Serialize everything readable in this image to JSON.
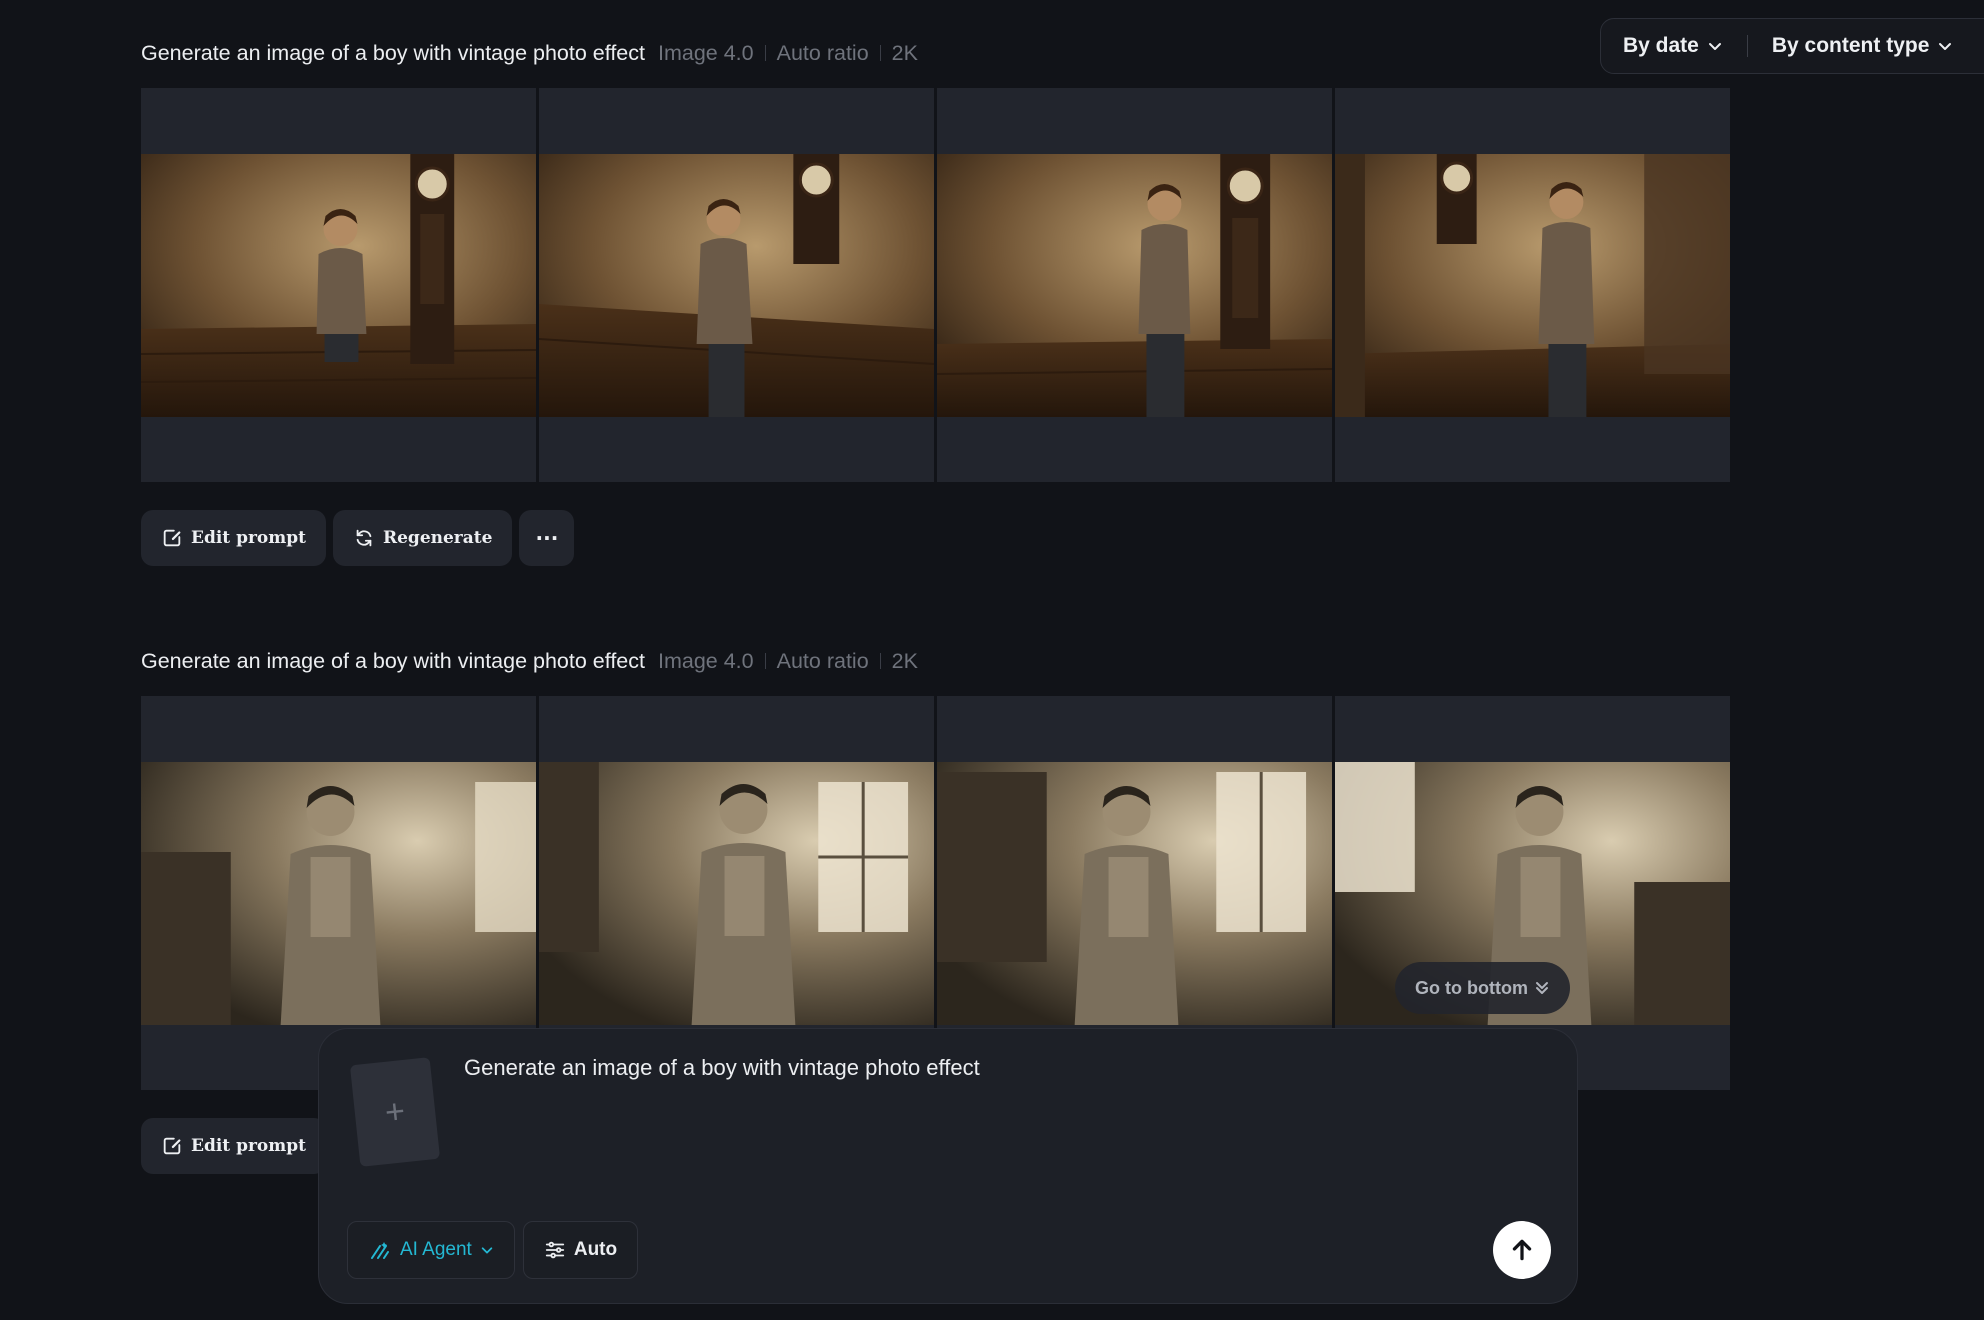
{
  "filters": {
    "by_date": "By date",
    "by_content_type": "By content type"
  },
  "generations": [
    {
      "prompt": "Generate an image of a boy with vintage photo effect",
      "model": "Image 4.0",
      "ratio": "Auto ratio",
      "resolution": "2K",
      "actions": {
        "edit": "Edit prompt",
        "regenerate": "Regenerate",
        "more": "···"
      }
    },
    {
      "prompt": "Generate an image of a boy with vintage photo effect",
      "model": "Image 4.0",
      "ratio": "Auto ratio",
      "resolution": "2K",
      "actions": {
        "edit": "Edit prompt"
      }
    }
  ],
  "go_to_bottom": "Go to bottom",
  "composer": {
    "text": "Generate an image of a boy with vintage photo effect",
    "add_symbol": "+",
    "agent_label": "AI Agent",
    "auto_label": "Auto"
  },
  "colors": {
    "background": "#111318",
    "panel": "#22252d",
    "accent": "#24b8d3"
  },
  "icons": [
    "chevron-down-icon",
    "edit-icon",
    "regenerate-icon",
    "more-icon",
    "double-chevron-down-icon",
    "plus-icon",
    "ai-agent-icon",
    "sliders-icon",
    "arrow-up-icon"
  ]
}
